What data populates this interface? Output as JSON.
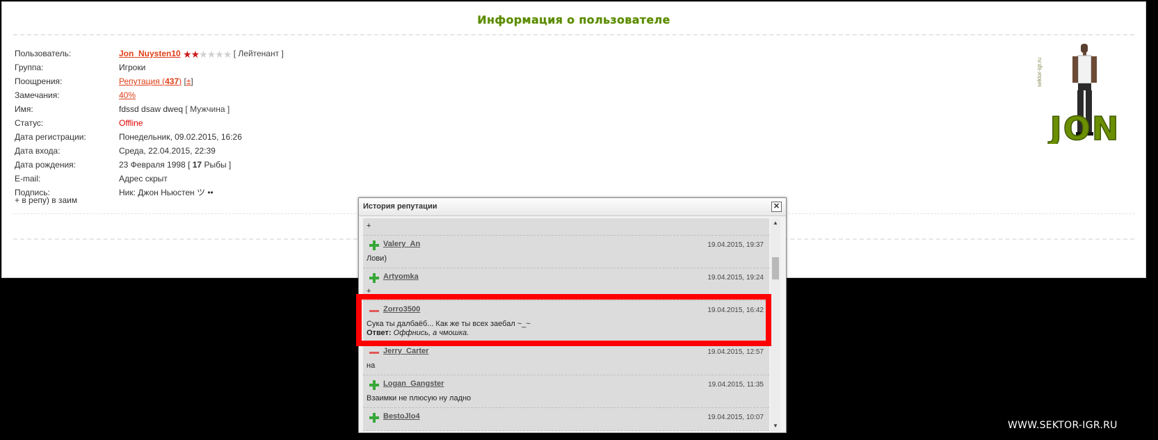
{
  "page": {
    "title": "Информация о пользователе"
  },
  "profile": {
    "rows": [
      {
        "label": "Пользователь:",
        "value": "Jon_Nuysten10"
      },
      {
        "label": "Группа:",
        "value": "Игроки"
      },
      {
        "label": "Поощрения:",
        "value": "Репутация"
      },
      {
        "label": "Замечания:",
        "value": "40%"
      },
      {
        "label": "Имя:",
        "value": "fdssd dsaw dweq"
      },
      {
        "label": "Статус:",
        "value": "Offline"
      },
      {
        "label": "Дата регистрации:",
        "value": "Понедельник, 09.02.2015, 16:26"
      },
      {
        "label": "Дата входа:",
        "value": "Среда, 22.04.2015, 22:39"
      },
      {
        "label": "Дата рождения:",
        "value": "23 Февраля 1998"
      },
      {
        "label": "E-mail:",
        "value": "Адрес скрыт"
      },
      {
        "label": "Подпись:",
        "value": "Ник: Джон Ньюстен ツ ••"
      }
    ],
    "rank": "Лейтенант",
    "stars_filled": 1.5,
    "stars_total": 5,
    "reputation_count": "437",
    "reputation_change": "±",
    "gender": "Мужчина",
    "age": "17",
    "zodiac": "Рыбы",
    "signature_line2": "+ в репу) в заим"
  },
  "avatar": {
    "watermark": "sektor-igr.ru",
    "logo_text": "JON"
  },
  "modal": {
    "title": "История репутации",
    "close_label": "✕",
    "entries": [
      {
        "sign": "none",
        "user": "",
        "date": "",
        "text": "+",
        "reply_label": "",
        "reply": ""
      },
      {
        "sign": "plus",
        "user": "Valery_An",
        "date": "19.04.2015, 19:37",
        "text": "Лови)",
        "reply_label": "",
        "reply": ""
      },
      {
        "sign": "plus",
        "user": "Artyomka",
        "date": "19.04.2015, 19:24",
        "text": "+",
        "reply_label": "",
        "reply": ""
      },
      {
        "sign": "minus",
        "user": "Zorro3500",
        "date": "19.04.2015, 16:42",
        "text": "Сука ты далбаёб... Как же ты всех заебал ~_~",
        "reply_label": "Ответ:",
        "reply": "Оффнись, а чмошка."
      },
      {
        "sign": "minus",
        "user": "Jerry_Carter",
        "date": "19.04.2015, 12:57",
        "text": "на",
        "reply_label": "",
        "reply": ""
      },
      {
        "sign": "plus",
        "user": "Logan_Gangster",
        "date": "19.04.2015, 11:35",
        "text": "Взаимки не плюсую ну ладно",
        "reply_label": "",
        "reply": ""
      },
      {
        "sign": "plus",
        "user": "BestoJlo4",
        "date": "19.04.2015, 10:07",
        "text": "",
        "reply_label": "",
        "reply": ""
      }
    ]
  },
  "watermark": "WWW.SEKTOR-IGR.RU",
  "colors": {
    "title_green": "#5a8a00",
    "link_red": "#e0401a",
    "highlight_red": "#ff0000",
    "plus_green": "#38a738",
    "minus_red": "#e05858"
  }
}
